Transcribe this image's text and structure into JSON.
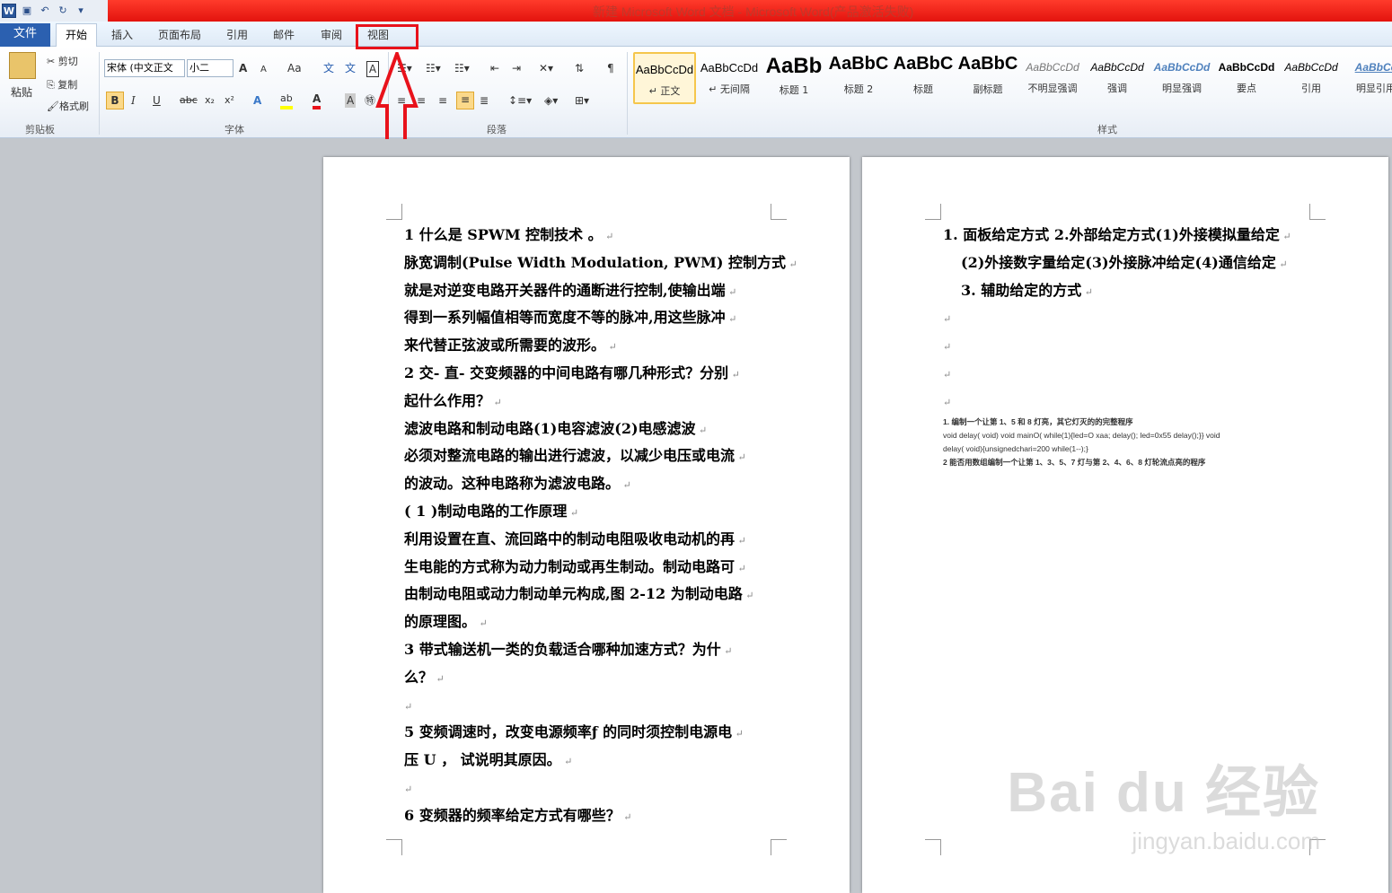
{
  "window": {
    "title": "新建 Microsoft Word 文档 - Microsoft Word(产品激活失败)"
  },
  "tabs": {
    "file": "文件",
    "home": "开始",
    "insert": "插入",
    "layout": "页面布局",
    "references": "引用",
    "mailings": "邮件",
    "review": "审阅",
    "view": "视图"
  },
  "clipboard": {
    "paste": "粘贴",
    "cut": "剪切",
    "copy": "复制",
    "format_painter": "格式刷",
    "label": "剪贴板"
  },
  "font": {
    "name": "宋体 (中文正文",
    "size": "小二",
    "label": "字体",
    "grow": "A",
    "shrink": "A",
    "case": "Aa",
    "bold": "B",
    "italic": "I",
    "underline": "U",
    "strike": "abc",
    "subscript": "x₂",
    "superscript": "x²"
  },
  "paragraph": {
    "label": "段落"
  },
  "styles": {
    "label": "样式",
    "items": [
      {
        "preview": "AaBbCcDd",
        "name": "↵ 正文"
      },
      {
        "preview": "AaBbCcDd",
        "name": "↵ 无间隔"
      },
      {
        "preview": "AaBb",
        "name": "标题 1"
      },
      {
        "preview": "AaBbC",
        "name": "标题 2"
      },
      {
        "preview": "AaBbC",
        "name": "标题"
      },
      {
        "preview": "AaBbC",
        "name": "副标题"
      },
      {
        "preview": "AaBbCcDd",
        "name": "不明显强调"
      },
      {
        "preview": "AaBbCcDd",
        "name": "强调"
      },
      {
        "preview": "AaBbCcDd",
        "name": "明显强调"
      },
      {
        "preview": "AaBbCcDd",
        "name": "要点"
      },
      {
        "preview": "AaBbCcDd",
        "name": "引用"
      },
      {
        "preview": "AaBbCc",
        "name": "明显引用"
      }
    ]
  },
  "page1": {
    "lines": [
      "1 什么是 SPWM 控制技术 。",
      "脉宽调制(Pulse Width Modulation, PWM) 控制方式",
      "就是对逆变电路开关器件的通断进行控制,使输出端",
      "得到一系列幅值相等而宽度不等的脉冲,用这些脉冲",
      "来代替正弦波或所需要的波形。",
      "2 交- 直- 交变频器的中间电路有哪几种形式？分别",
      "起什么作用？",
      "滤波电路和制动电路(1)电容滤波(2)电感滤波",
      "必须对整流电路的输出进行滤波，以减少电压或电流",
      "的波动。这种电路称为滤波电路。",
      "( 1 )制动电路的工作原理",
      "利用设置在直、流回路中的制动电阻吸收电动机的再",
      "生电能的方式称为动力制动或再生制动。制动电路可",
      "由制动电阻或动力制动单元构成,图 2-12 为制动电路",
      "的原理图。",
      "3 带式输送机一类的负载适合哪种加速方式？为什",
      "么？",
      "",
      "5 变频调速时，改变电源频率ƒ 的同时须控制电源电",
      "压 U ， 试说明其原因。",
      "",
      "6 变频器的频率给定方式有哪些？"
    ]
  },
  "page2": {
    "lines": [
      "1. 面板给定方式 2.外部给定方式(1)外接模拟量给定",
      "(2)外接数字量给定(3)外接脉冲给定(4)通信给定",
      "3. 辅助给定的方式",
      "",
      "",
      "",
      ""
    ],
    "small": [
      "1.  编制一个让第 1、5 和 8 灯亮，其它灯灭的的完整程序",
      "void  delay(  void)  void  mainO(  while(1){led=O  xaa;  delay();  led=0x55  delay();}}  void",
      "delay( void){unsignedchari=200  while(1--);}",
      "2  能否用数组编制一个让第 1、3、5、7 灯与第 2、4、6、8 灯轮流点亮的程序"
    ]
  },
  "watermark": {
    "brand": "Bai du 经验",
    "url": "jingyan.baidu.com"
  }
}
